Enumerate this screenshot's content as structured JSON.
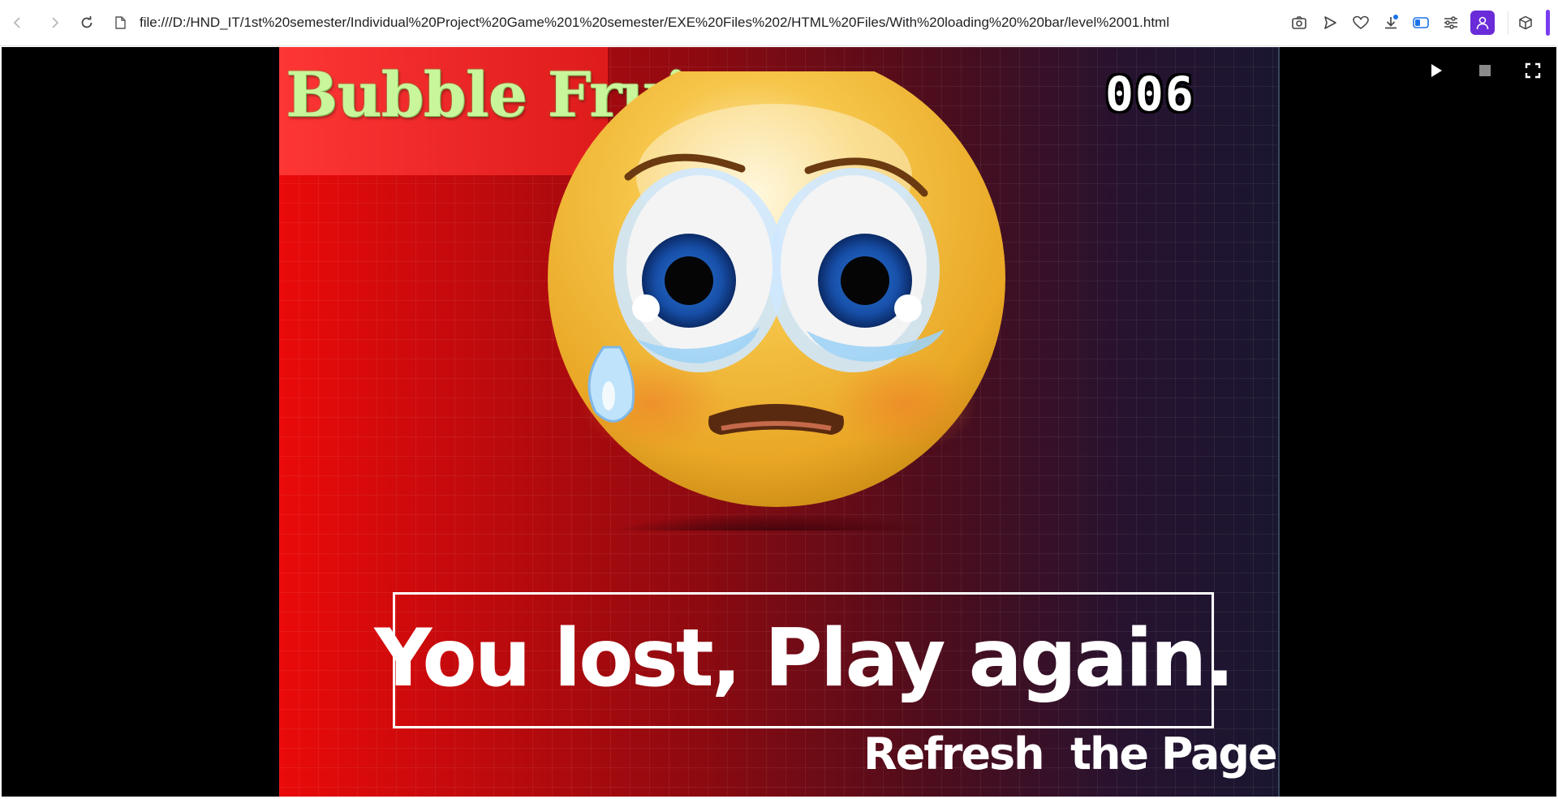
{
  "browser": {
    "url": "file:///D:/HND_IT/1st%20semester/Individual%20Project%20Game%201%20semester/EXE%20Files%202/HTML%20Files/With%20loading%20%20bar/level%2001.html",
    "nav_icons": [
      "back-icon",
      "forward-icon",
      "reload-icon"
    ],
    "toolbar_icons": [
      "camera-icon",
      "send-icon",
      "heart-icon",
      "download-icon",
      "sidebar-icon",
      "settings-icon",
      "profile-icon",
      "extensions-icon"
    ],
    "accent_color": "#6a2bd9"
  },
  "game": {
    "title": "Bubble Fruit",
    "score": "006",
    "lose_message": "You lost, Play again.",
    "refresh_message": "Refresh  the Page",
    "title_color": "#c9f59b"
  },
  "player_controls": {
    "icons": [
      "play-icon",
      "stop-icon",
      "fullscreen-icon"
    ]
  }
}
